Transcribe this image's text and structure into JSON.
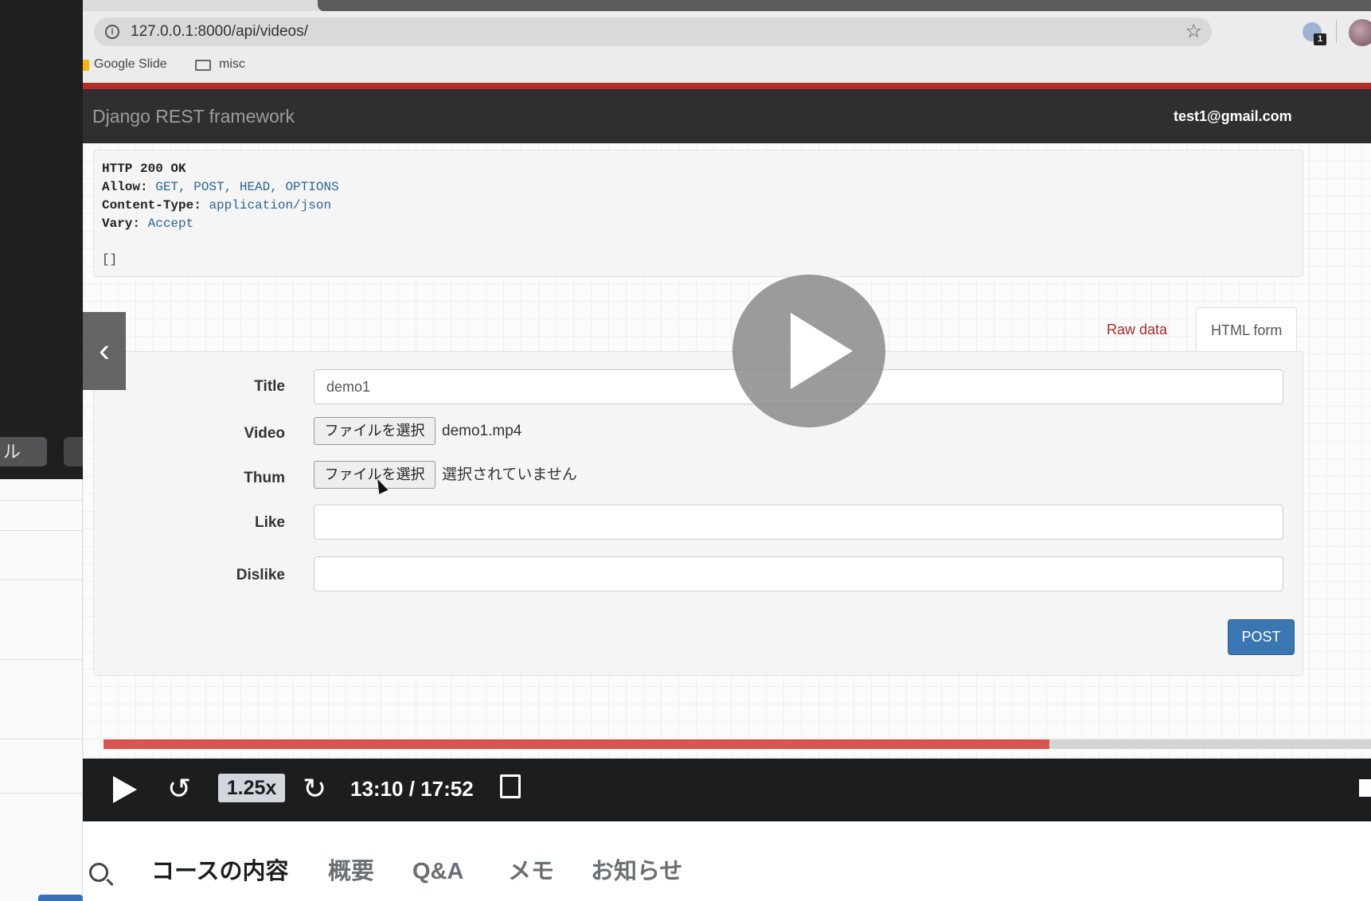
{
  "left_panel": {
    "pill_label": "ル"
  },
  "browser": {
    "url": "127.0.0.1:8000/api/videos/",
    "ext_badge": "1",
    "bookmarks": [
      {
        "label": "Google Slide"
      },
      {
        "label": "misc"
      }
    ]
  },
  "drf": {
    "brand": "Django REST framework",
    "user": "test1@gmail.com",
    "response": {
      "status": "HTTP 200 OK",
      "headers": [
        {
          "key": "Allow:",
          "value": "GET, POST, HEAD, OPTIONS"
        },
        {
          "key": "Content-Type:",
          "value": "application/json"
        },
        {
          "key": "Vary:",
          "value": "Accept"
        }
      ],
      "body": "[]"
    },
    "tabs": {
      "raw": "Raw data",
      "html": "HTML form"
    },
    "form": {
      "title_label": "Title",
      "title_value": "demo1",
      "video_label": "Video",
      "video_button": "ファイルを選択",
      "video_file": "demo1.mp4",
      "thum_label": "Thum",
      "thum_button": "ファイルを選択",
      "thum_file": "選択されていません",
      "like_label": "Like",
      "like_value": "",
      "dislike_label": "Dislike",
      "dislike_value": "",
      "post_button": "POST"
    }
  },
  "player": {
    "progress_fraction": 0.746,
    "speed": "1.25x",
    "time": "13:10 / 17:52",
    "rewind_glyph": "↺",
    "forward_glyph": "↻",
    "prev_glyph": "‹"
  },
  "course_tabs": [
    "コースの内容",
    "概要",
    "Q&A",
    "メモ",
    "お知らせ"
  ],
  "colors": {
    "accent_red": "#d9534f",
    "drf_red": "#b42d28",
    "post_blue": "#3a77b2",
    "player_bg": "#1c1d1f"
  }
}
